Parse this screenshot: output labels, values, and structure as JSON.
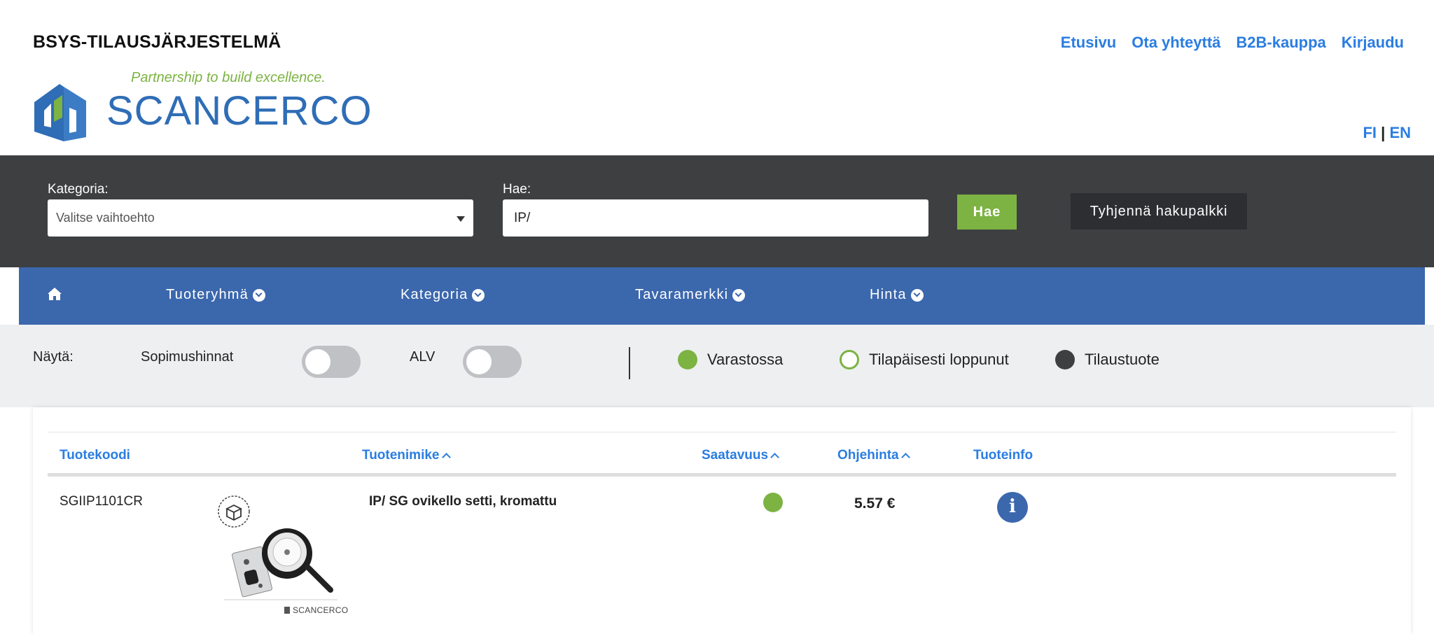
{
  "header": {
    "site_title": "BSYS-TILAUSJÄRJESTELMÄ",
    "nav": [
      "Etusivu",
      "Ota yhteyttä",
      "B2B-kauppa",
      "Kirjaudu"
    ],
    "logo_tagline": "Partnership to build excellence.",
    "logo_wordmark": "SCANCERCO",
    "lang_fi": "FI",
    "lang_sep": "|",
    "lang_en": "EN"
  },
  "search": {
    "category_label": "Kategoria:",
    "category_value": "Valitse vaihtoehto",
    "query_label": "Hae:",
    "query_value": "IP/",
    "search_button": "Hae",
    "clear_button": "Tyhjennä hakupalkki"
  },
  "filters": {
    "home_icon": "home-icon",
    "items": [
      "Tuoteryhmä",
      "Kategoria",
      "Tavaramerkki",
      "Hinta"
    ]
  },
  "options": {
    "show_label": "Näytä:",
    "contract_prices_label": "Sopimushinnat",
    "contract_prices_on": false,
    "vat_label": "ALV",
    "vat_on": false,
    "legend": [
      {
        "label": "Varastossa",
        "style": "filled-green"
      },
      {
        "label": "Tilapäisesti loppunut",
        "style": "ring-green"
      },
      {
        "label": "Tilaustuote",
        "style": "filled-dark"
      }
    ]
  },
  "table": {
    "columns": [
      "Tuotekoodi",
      "Tuotenimike",
      "Saatavuus",
      "Ohjehinta",
      "Tuoteinfo"
    ],
    "rows": [
      {
        "code": "SGIIP1101CR",
        "name": "IP/ SG ovikello setti, kromattu",
        "availability": "Varastossa",
        "price": "5.57 €",
        "image_brand": "SCANCERCO"
      }
    ]
  },
  "colors": {
    "accent_blue": "#2a7de1",
    "nav_blue": "#3b67ad",
    "green": "#7cb342",
    "dark_bar": "#3e3f41"
  }
}
